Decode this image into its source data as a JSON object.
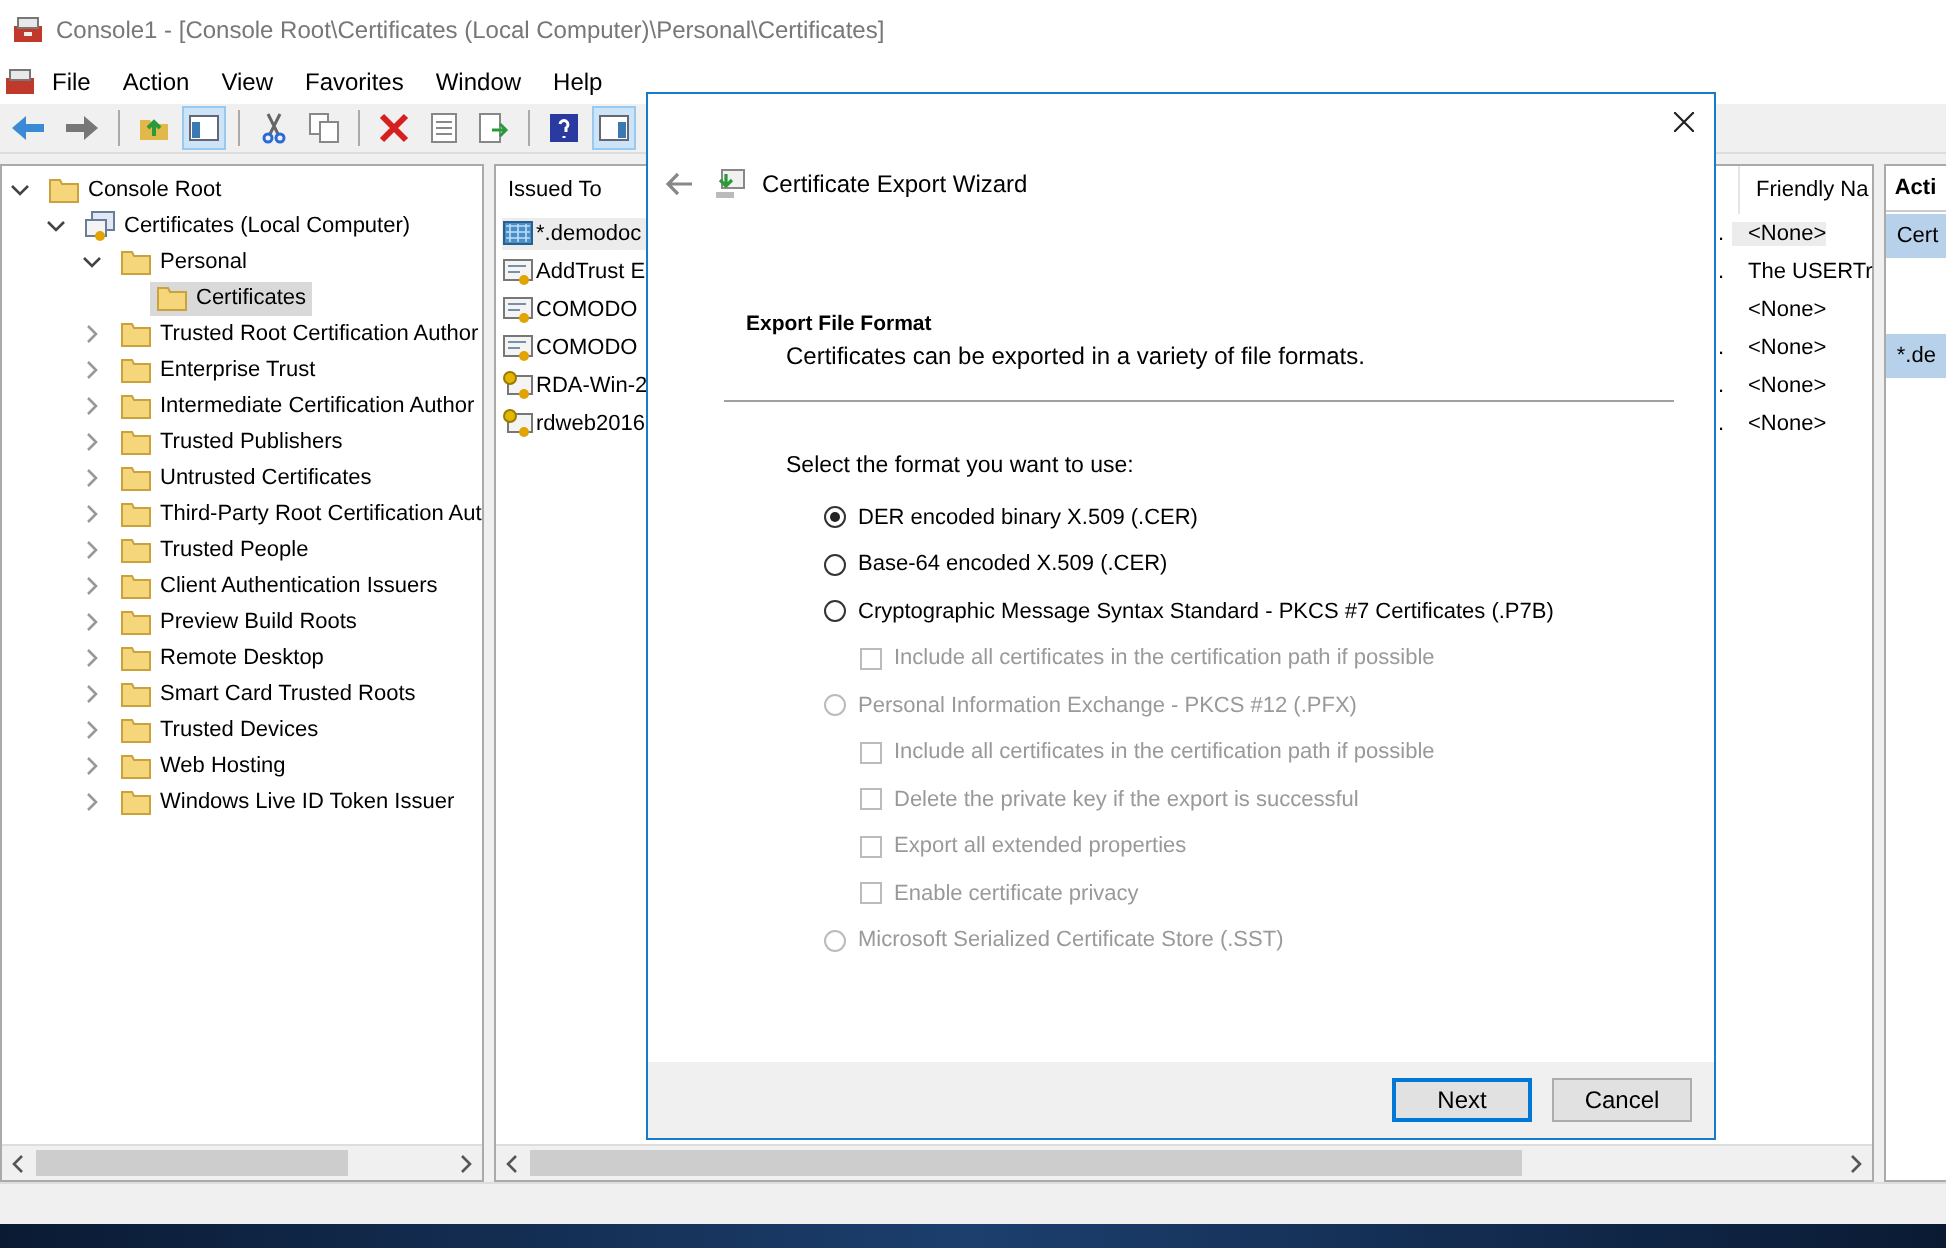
{
  "window": {
    "title": "Console1 - [Console Root\\Certificates (Local Computer)\\Personal\\Certificates]"
  },
  "menu": [
    "File",
    "Action",
    "View",
    "Favorites",
    "Window",
    "Help"
  ],
  "tree": [
    {
      "label": "Console Root",
      "expanded": true,
      "selected": false,
      "children": [
        {
          "label": "Certificates (Local Computer)",
          "kind": "snapin",
          "expanded": true,
          "selected": false,
          "children": [
            {
              "label": "Personal",
              "expanded": true,
              "selected": false,
              "children": [
                {
                  "label": "Certificates",
                  "selected": true
                }
              ]
            },
            {
              "label": "Trusted Root Certification Author",
              "expanded": false,
              "selected": false
            },
            {
              "label": "Enterprise Trust",
              "expanded": false,
              "selected": false
            },
            {
              "label": "Intermediate Certification Author",
              "expanded": false,
              "selected": false
            },
            {
              "label": "Trusted Publishers",
              "expanded": false,
              "selected": false
            },
            {
              "label": "Untrusted Certificates",
              "expanded": false,
              "selected": false
            },
            {
              "label": "Third-Party Root Certification Aut",
              "expanded": false,
              "selected": false
            },
            {
              "label": "Trusted People",
              "expanded": false,
              "selected": false
            },
            {
              "label": "Client Authentication Issuers",
              "expanded": false,
              "selected": false
            },
            {
              "label": "Preview Build Roots",
              "expanded": false,
              "selected": false
            },
            {
              "label": "Remote Desktop",
              "expanded": false,
              "selected": false
            },
            {
              "label": "Smart Card Trusted Roots",
              "expanded": false,
              "selected": false
            },
            {
              "label": "Trusted Devices",
              "expanded": false,
              "selected": false
            },
            {
              "label": "Web Hosting",
              "expanded": false,
              "selected": false
            },
            {
              "label": "Windows Live ID Token Issuer",
              "expanded": false,
              "selected": false
            }
          ]
        }
      ]
    }
  ],
  "list": {
    "columns": [
      "Issued To",
      "Friendly Na"
    ],
    "rows": [
      {
        "issued_to": "*.demodoc",
        "column_2": ".",
        "friendly_name": "<None>",
        "kind": "wildcard",
        "selected": true
      },
      {
        "issued_to": "AddTrust E",
        "column_2": ".",
        "friendly_name": "The USERTr",
        "kind": "cert",
        "selected": false
      },
      {
        "issued_to": "COMODO",
        "friendly_name": "<None>",
        "kind": "cert",
        "selected": false
      },
      {
        "issued_to": "COMODO",
        "column_2": ".",
        "friendly_name": "<None>",
        "kind": "cert",
        "selected": false
      },
      {
        "issued_to": "RDA-Win-2",
        "column_2": ".",
        "friendly_name": "<None>",
        "kind": "key",
        "selected": false
      },
      {
        "issued_to": "rdweb2016",
        "column_2": ".",
        "friendly_name": "<None>",
        "kind": "key",
        "selected": false
      }
    ]
  },
  "actions": {
    "title": "Acti",
    "sections": [
      "Cert",
      "*.de"
    ]
  },
  "dialog": {
    "title": "Certificate Export Wizard",
    "heading": "Export File Format",
    "subtitle": "Certificates can be exported in a variety of file formats.",
    "prompt": "Select the format you want to use:",
    "options": [
      {
        "label": "DER encoded binary X.509 (.CER)",
        "selected": true,
        "disabled": false
      },
      {
        "label": "Base-64 encoded X.509 (.CER)",
        "selected": false,
        "disabled": false
      },
      {
        "label": "Cryptographic Message Syntax Standard - PKCS #7 Certificates (.P7B)",
        "selected": false,
        "disabled": false,
        "children": [
          {
            "label": "Include all certificates in the certification path if possible",
            "checked": false,
            "disabled": true
          }
        ]
      },
      {
        "label": "Personal Information Exchange - PKCS #12 (.PFX)",
        "selected": false,
        "disabled": true,
        "children": [
          {
            "label": "Include all certificates in the certification path if possible",
            "checked": false,
            "disabled": true
          },
          {
            "label": "Delete the private key if the export is successful",
            "checked": false,
            "disabled": true
          },
          {
            "label": "Export all extended properties",
            "checked": false,
            "disabled": true
          },
          {
            "label": "Enable certificate privacy",
            "checked": false,
            "disabled": true
          }
        ]
      },
      {
        "label": "Microsoft Serialized Certificate Store (.SST)",
        "selected": false,
        "disabled": true
      }
    ],
    "buttons": [
      {
        "label": "Next",
        "default": true
      },
      {
        "label": "Cancel",
        "default": false
      }
    ]
  }
}
